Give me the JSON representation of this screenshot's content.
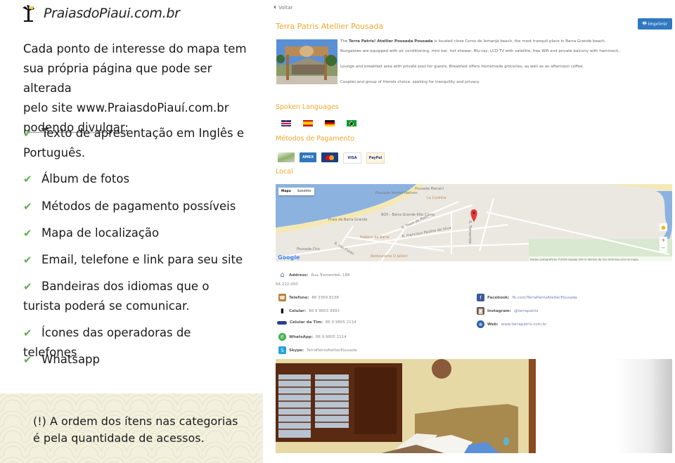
{
  "left": {
    "brand": "PraiasdoPiaui.com.br",
    "intro_lines": [
      "Cada ponto de interesse do mapa tem",
      "sua própria página que pode ser alterada",
      "pelo site www.PraiasdoPiauí.com.br"
    ],
    "intro_underlined": "podendo divulgar",
    "intro_suffix": ":",
    "features": [
      "Texto de apresentação em Inglês e Português.",
      "Álbum de fotos",
      "Métodos de pagamento possíveis",
      "Mapa de localização",
      "Email, telefone e link para seu site",
      "Bandeiras dos idiomas que o turista poderá se comunicar.",
      "Ícones das operadoras de telefones",
      "Whatsapp"
    ],
    "note_line1": "(!) A ordem dos ítens nas categorias",
    "note_line2": "é pela quantidade de acessos."
  },
  "page": {
    "back_label": "Voltar",
    "title": "Terra Patris Atellier Pousada",
    "print_label": "Imprimir",
    "description": {
      "p1_prefix": "The ",
      "p1_bold": "Terra Patris! Atellier Pousada Pousada",
      "p1_rest": " is located close Corso de Iemanjá beach, the most tranquil place in Barra Grande beach.",
      "p2": "Bungalows are equipped with air conditioning, mini bar, hot shower, Blu-ray, LCD TV with satellite, free Wifi and private balcony with hammock.",
      "p3": "Lounge and breakfast area with private pool for guests. Breakfast offers homemade groceries, as well as an afternoon coffee.",
      "p4": "Couples and group of friends choice: seeking for tranquility and privacy."
    },
    "languages_heading": "Spoken Languages",
    "languages": [
      "English",
      "Spanish",
      "German",
      "Portuguese"
    ],
    "payment_heading": "Métodos de Pagamento",
    "payments": [
      "Cash",
      "American Express",
      "MasterCard",
      "VISA",
      "PayPal"
    ],
    "local_heading": "Local",
    "map": {
      "type_buttons": [
        "Mapa",
        "Satélite"
      ],
      "labels": [
        "Pousada Manairi",
        "Pousada Ventos Nativos",
        "La Cozinha",
        "BOX - Barra Grande Kite Camp",
        "Praia de Barra Grande",
        "R. Treze de Maio",
        "R. Francisco Paulino da Silva",
        "Padaria da Barra",
        "R. das Flores",
        "Pousada Chic",
        "Restaurante O Jalleiri",
        "R. Tremembé"
      ],
      "footer": "Dados cartográficos ©2016 Google   100 m   Termos de Uso   Informar erro no mapa",
      "zoom_in": "+",
      "zoom_out": "−",
      "logo": "Google"
    },
    "contacts_left": [
      {
        "icon": "home-icon",
        "label": "Address:",
        "value": "Rua Tremembé, 188"
      },
      {
        "icon": "phone-icon",
        "label": "Telefone:",
        "value": "86 3369 8138"
      },
      {
        "icon": "mobile-icon",
        "label": "Celular:",
        "value": "86 9 9803 9993"
      },
      {
        "icon": "tim-icon",
        "label": "Celular da Tim:",
        "value": "86 9 9805 2114"
      },
      {
        "icon": "whatsapp-icon",
        "label": "WhatsApp:",
        "value": "86 9 9805 2114"
      },
      {
        "icon": "skype-icon",
        "label": "Skype:",
        "value": "TerraPatrisAtellierPousada"
      }
    ],
    "address_cep": "64.222-000",
    "contacts_right": [
      {
        "icon": "facebook-icon",
        "label": "Facebook:",
        "value": "fb.com/TerraPatrisAtellierPousada"
      },
      {
        "icon": "instagram-icon",
        "label": "Instagram:",
        "value": "@terrapatris"
      },
      {
        "icon": "web-icon",
        "label": "Web:",
        "value": "www.terrapatris.com.br"
      }
    ]
  }
}
